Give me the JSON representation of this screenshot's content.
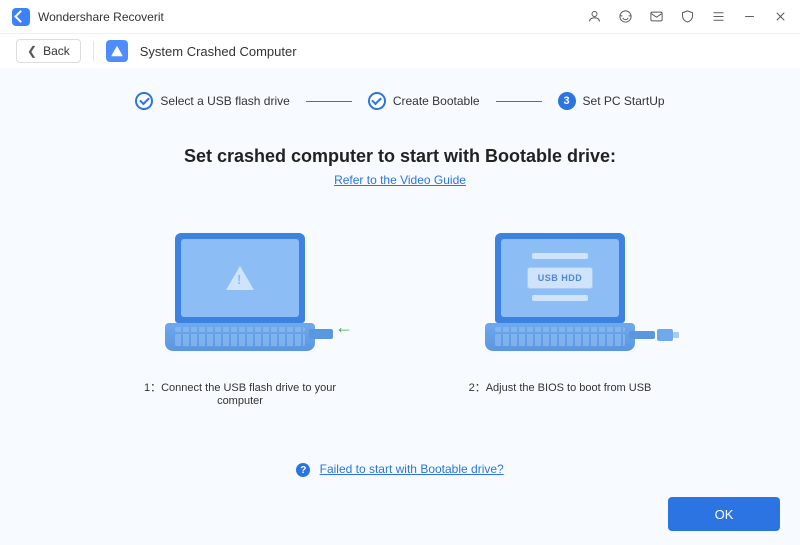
{
  "app": {
    "title": "Wondershare Recoverit"
  },
  "nav": {
    "back": "Back",
    "mode": "System Crashed Computer"
  },
  "steps": {
    "s1": "Select a USB flash drive",
    "s2": "Create Bootable",
    "s3": "Set PC StartUp",
    "current_num": "3"
  },
  "main": {
    "heading": "Set crashed computer to start with Bootable drive:",
    "guide_link": "Refer to the Video Guide",
    "caption1": "1：Connect the USB flash drive to your computer",
    "caption2": "2：Adjust the BIOS to boot from USB",
    "usb_label": "USB HDD",
    "help_link": "Failed to start with Bootable drive?"
  },
  "footer": {
    "ok": "OK"
  }
}
